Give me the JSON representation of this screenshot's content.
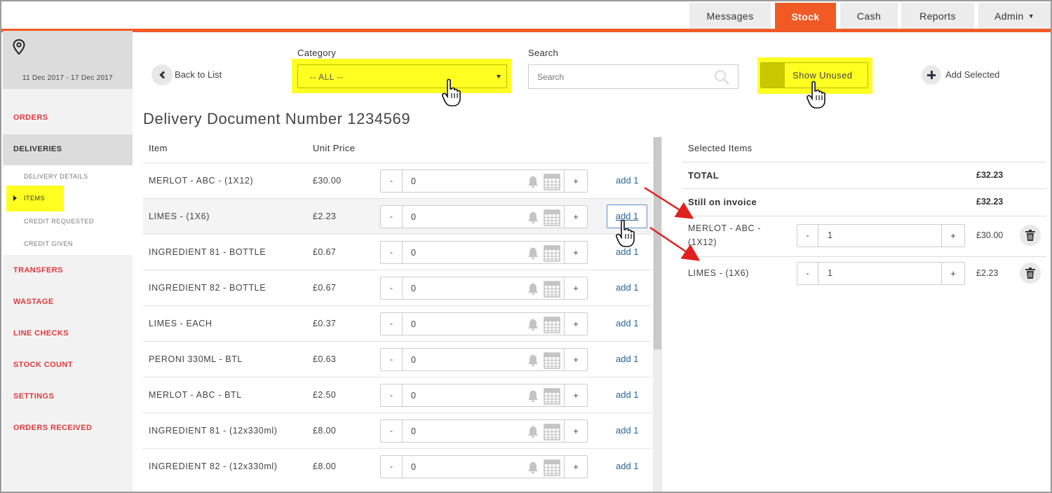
{
  "nav": {
    "tabs": [
      {
        "label": "Messages"
      },
      {
        "label": "Stock"
      },
      {
        "label": "Cash"
      },
      {
        "label": "Reports"
      },
      {
        "label": "Admin"
      }
    ],
    "active": "Stock",
    "accent": "#f15a24"
  },
  "sidebar": {
    "date_range": "11 Dec 2017 - 17 Dec 2017",
    "items": [
      {
        "label": "ORDERS"
      },
      {
        "label": "DELIVERIES"
      },
      {
        "label": "TRANSFERS"
      },
      {
        "label": "WASTAGE"
      },
      {
        "label": "LINE CHECKS"
      },
      {
        "label": "STOCK COUNT"
      },
      {
        "label": "SETTINGS"
      },
      {
        "label": "ORDERS RECEIVED"
      }
    ],
    "sub_items": [
      {
        "label": "DELIVERY DETAILS"
      },
      {
        "label": "ITEMS"
      },
      {
        "label": "CREDIT REQUESTED"
      },
      {
        "label": "CREDIT GIVEN"
      }
    ]
  },
  "toolbar": {
    "back_label": "Back to List",
    "category_label": "Category",
    "category_value": "-- ALL --",
    "search_label": "Search",
    "search_placeholder": "Search",
    "show_unused_label": "Show Unused",
    "add_selected_label": "Add Selected"
  },
  "title": "Delivery Document Number 1234569",
  "table": {
    "headers": {
      "item": "Item",
      "unit_price": "Unit Price"
    },
    "minus": "-",
    "plus": "+",
    "rows": [
      {
        "name": "MERLOT - ABC - (1X12)",
        "price": "£30.00",
        "qty": "0",
        "action": "add 1"
      },
      {
        "name": "LIMES - (1X6)",
        "price": "£2.23",
        "qty": "0",
        "action": "add 1"
      },
      {
        "name": "INGREDIENT 81 - BOTTLE",
        "price": "£0.67",
        "qty": "0",
        "action": "add 1"
      },
      {
        "name": "INGREDIENT 82 - BOTTLE",
        "price": "£0.67",
        "qty": "0",
        "action": "add 1"
      },
      {
        "name": "LIMES - EACH",
        "price": "£0.37",
        "qty": "0",
        "action": "add 1"
      },
      {
        "name": "PERONI 330ML - BTL",
        "price": "£0.63",
        "qty": "0",
        "action": "add 1"
      },
      {
        "name": "MERLOT - ABC - BTL",
        "price": "£2.50",
        "qty": "0",
        "action": "add 1"
      },
      {
        "name": "INGREDIENT 81 - (12x330ml)",
        "price": "£8.00",
        "qty": "0",
        "action": "add 1"
      },
      {
        "name": "INGREDIENT 82 - (12x330ml)",
        "price": "£8.00",
        "qty": "0",
        "action": "add 1"
      }
    ]
  },
  "selected": {
    "title": "Selected Items",
    "total_label": "TOTAL",
    "total_value": "£32.23",
    "invoice_label": "Still on invoice",
    "invoice_value": "£32.23",
    "items": [
      {
        "name": "MERLOT - ABC - (1X12)",
        "qty": "1",
        "price": "£30.00"
      },
      {
        "name": "LIMES - (1X6)",
        "qty": "1",
        "price": "£2.23"
      }
    ]
  },
  "colors": {
    "highlight": "#ffff22",
    "sidebar_link": "#e0393e",
    "link": "#2a6496",
    "annotation_arrow": "#e02020"
  }
}
